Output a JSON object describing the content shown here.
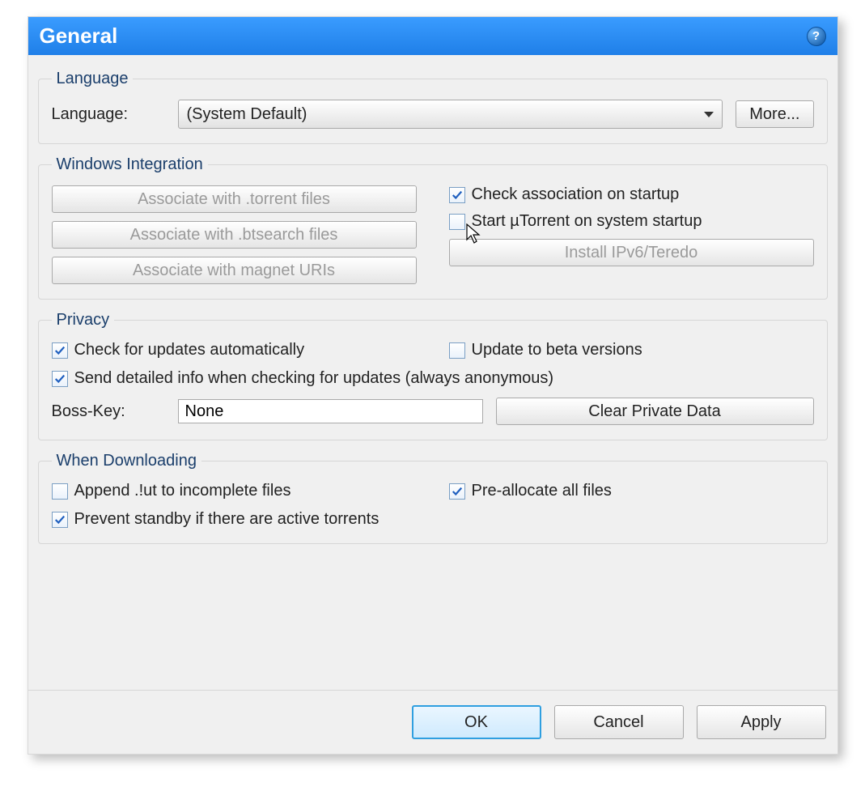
{
  "title": "General",
  "language_section": {
    "legend": "Language",
    "label": "Language:",
    "selected": "(System Default)",
    "more_btn": "More..."
  },
  "windows_integration": {
    "legend": "Windows Integration",
    "assoc_torrent_btn": "Associate with .torrent files",
    "assoc_btsearch_btn": "Associate with .btsearch files",
    "assoc_magnet_btn": "Associate with magnet URIs",
    "check_assoc_label": "Check association on startup",
    "check_assoc_checked": true,
    "start_on_boot_label": "Start µTorrent on system startup",
    "start_on_boot_checked": false,
    "install_ipv6_btn": "Install IPv6/Teredo"
  },
  "privacy": {
    "legend": "Privacy",
    "auto_update_label": "Check for updates automatically",
    "auto_update_checked": true,
    "beta_label": "Update to beta versions",
    "beta_checked": false,
    "detailed_info_label": "Send detailed info when checking for updates (always anonymous)",
    "detailed_info_checked": true,
    "bosskey_label": "Boss-Key:",
    "bosskey_value": "None",
    "clear_btn": "Clear Private Data"
  },
  "downloading": {
    "legend": "When Downloading",
    "append_ut_label": "Append .!ut to incomplete files",
    "append_ut_checked": false,
    "preallocate_label": "Pre-allocate all files",
    "preallocate_checked": true,
    "prevent_standby_label": "Prevent standby if there are active torrents",
    "prevent_standby_checked": true
  },
  "footer": {
    "ok": "OK",
    "cancel": "Cancel",
    "apply": "Apply"
  }
}
